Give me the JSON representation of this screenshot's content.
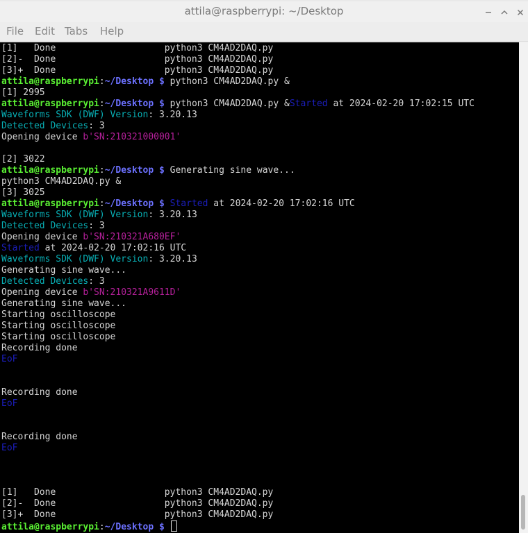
{
  "window": {
    "title": "attila@raspberrypi: ~/Desktop"
  },
  "menu": [
    "File",
    "Edit",
    "Tabs",
    "Help"
  ],
  "colors": {
    "prompt_user": "#5af033",
    "prompt_path": "#6c71ff",
    "cyan": "#08b0b6",
    "blue": "#1b1ebc",
    "magenta": "#b6209b",
    "text": "#d6d6d6",
    "background": "#000000"
  },
  "terminal": {
    "lines": [
      [
        {
          "t": "[1]   Done                    python3 CM4AD2DAQ.py",
          "c": "text"
        }
      ],
      [
        {
          "t": "[2]-  Done                    python3 CM4AD2DAQ.py",
          "c": "text"
        }
      ],
      [
        {
          "t": "[3]+  Done                    python3 CM4AD2DAQ.py",
          "c": "text"
        }
      ],
      [
        {
          "t": "attila@raspberrypi",
          "c": "prompt_user",
          "b": true
        },
        {
          "t": ":",
          "c": "text"
        },
        {
          "t": "~/Desktop $",
          "c": "prompt_path",
          "b": true
        },
        {
          "t": " python3 CM4AD2DAQ.py &",
          "c": "text"
        }
      ],
      [
        {
          "t": "[1] 2995",
          "c": "text"
        }
      ],
      [
        {
          "t": "attila@raspberrypi",
          "c": "prompt_user",
          "b": true
        },
        {
          "t": ":",
          "c": "text"
        },
        {
          "t": "~/Desktop $",
          "c": "prompt_path",
          "b": true
        },
        {
          "t": " python3 CM4AD2DAQ.py &",
          "c": "text"
        },
        {
          "t": "Started",
          "c": "blue"
        },
        {
          "t": " at 2024-02-20 17:02:15 UTC",
          "c": "text"
        }
      ],
      [
        {
          "t": "Waveforms SDK (DWF) Version",
          "c": "cyan"
        },
        {
          "t": ": 3.20.13",
          "c": "text"
        }
      ],
      [
        {
          "t": "Detected Devices",
          "c": "cyan"
        },
        {
          "t": ": 3",
          "c": "text"
        }
      ],
      [
        {
          "t": "Opening device ",
          "c": "text"
        },
        {
          "t": "b'SN:210321000001'",
          "c": "magenta"
        }
      ],
      [],
      [
        {
          "t": "[2] 3022",
          "c": "text"
        }
      ],
      [
        {
          "t": "attila@raspberrypi",
          "c": "prompt_user",
          "b": true
        },
        {
          "t": ":",
          "c": "text"
        },
        {
          "t": "~/Desktop $",
          "c": "prompt_path",
          "b": true
        },
        {
          "t": " Generating sine wave...",
          "c": "text"
        }
      ],
      [
        {
          "t": "python3 CM4AD2DAQ.py &",
          "c": "text"
        }
      ],
      [
        {
          "t": "[3] 3025",
          "c": "text"
        }
      ],
      [
        {
          "t": "attila@raspberrypi",
          "c": "prompt_user",
          "b": true
        },
        {
          "t": ":",
          "c": "text"
        },
        {
          "t": "~/Desktop $",
          "c": "prompt_path",
          "b": true
        },
        {
          "t": " ",
          "c": "text"
        },
        {
          "t": "Started",
          "c": "blue"
        },
        {
          "t": " at 2024-02-20 17:02:16 UTC",
          "c": "text"
        }
      ],
      [
        {
          "t": "Waveforms SDK (DWF) Version",
          "c": "cyan"
        },
        {
          "t": ": 3.20.13",
          "c": "text"
        }
      ],
      [
        {
          "t": "Detected Devices",
          "c": "cyan"
        },
        {
          "t": ": 3",
          "c": "text"
        }
      ],
      [
        {
          "t": "Opening device ",
          "c": "text"
        },
        {
          "t": "b'SN:210321A680EF'",
          "c": "magenta"
        }
      ],
      [
        {
          "t": "Started",
          "c": "blue"
        },
        {
          "t": " at 2024-02-20 17:02:16 UTC",
          "c": "text"
        }
      ],
      [
        {
          "t": "Waveforms SDK (DWF) Version",
          "c": "cyan"
        },
        {
          "t": ": 3.20.13",
          "c": "text"
        }
      ],
      [
        {
          "t": "Generating sine wave...",
          "c": "text"
        }
      ],
      [
        {
          "t": "Detected Devices",
          "c": "cyan"
        },
        {
          "t": ": 3",
          "c": "text"
        }
      ],
      [
        {
          "t": "Opening device ",
          "c": "text"
        },
        {
          "t": "b'SN:210321A9611D'",
          "c": "magenta"
        }
      ],
      [
        {
          "t": "Generating sine wave...",
          "c": "text"
        }
      ],
      [
        {
          "t": "Starting oscilloscope",
          "c": "text"
        }
      ],
      [
        {
          "t": "Starting oscilloscope",
          "c": "text"
        }
      ],
      [
        {
          "t": "Starting oscilloscope",
          "c": "text"
        }
      ],
      [
        {
          "t": "Recording done",
          "c": "text"
        }
      ],
      [
        {
          "t": "EoF",
          "c": "blue"
        }
      ],
      [],
      [],
      [
        {
          "t": "Recording done",
          "c": "text"
        }
      ],
      [
        {
          "t": "EoF",
          "c": "blue"
        }
      ],
      [],
      [],
      [
        {
          "t": "Recording done",
          "c": "text"
        }
      ],
      [
        {
          "t": "EoF",
          "c": "blue"
        }
      ],
      [],
      [],
      [],
      [
        {
          "t": "[1]   Done                    python3 CM4AD2DAQ.py",
          "c": "text"
        }
      ],
      [
        {
          "t": "[2]-  Done                    python3 CM4AD2DAQ.py",
          "c": "text"
        }
      ],
      [
        {
          "t": "[3]+  Done                    python3 CM4AD2DAQ.py",
          "c": "text"
        }
      ],
      [
        {
          "t": "attila@raspberrypi",
          "c": "prompt_user",
          "b": true
        },
        {
          "t": ":",
          "c": "text"
        },
        {
          "t": "~/Desktop $",
          "c": "prompt_path",
          "b": true
        },
        {
          "t": " ",
          "c": "text"
        }
      ]
    ]
  }
}
